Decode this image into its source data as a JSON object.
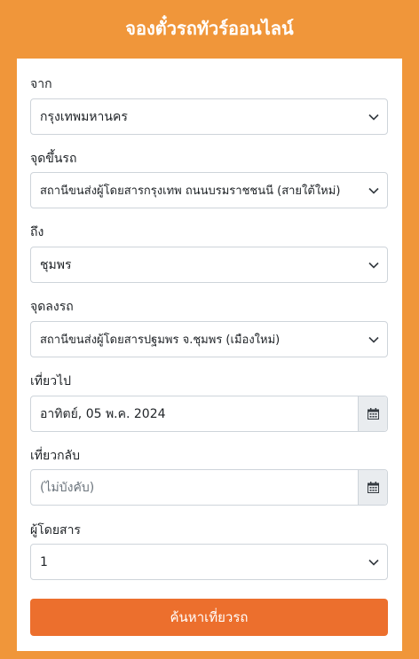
{
  "header": {
    "title": "จองตั๋วรถทัวร์ออนไลน์"
  },
  "form": {
    "from": {
      "label": "จาก",
      "value": "กรุงเทพมหานคร"
    },
    "boarding": {
      "label": "จุดขึ้นรถ",
      "value": "สถานีขนส่งผู้โดยสารกรุงเทพ ถนนบรมราชชนนี (สายใต้ใหม่)"
    },
    "to": {
      "label": "ถึง",
      "value": "ชุมพร"
    },
    "dropoff": {
      "label": "จุดลงรถ",
      "value": "สถานีขนส่งผู้โดยสารปฐมพร จ.ชุมพร (เมืองใหม่)"
    },
    "depart": {
      "label": "เที่ยวไป",
      "value": "อาทิตย์, 05 พ.ค. 2024"
    },
    "return": {
      "label": "เที่ยวกลับ",
      "placeholder": "(ไม่บังคับ)"
    },
    "passengers": {
      "label": "ผู้โดยสาร",
      "value": "1"
    },
    "submit_label": "ค้นหาเที่ยวรถ"
  },
  "icons": {
    "select": "chevron-down-icon",
    "date": "calendar-icon"
  },
  "colors": {
    "background": "#f0963a",
    "button": "#ec6f2d"
  }
}
